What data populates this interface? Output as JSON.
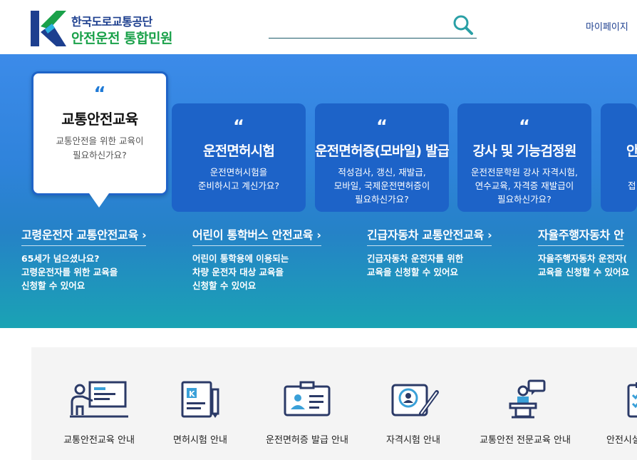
{
  "header": {
    "logo_top": "한국도로교통공단",
    "logo_bottom": "안전운전 통합민원",
    "search_placeholder": "",
    "mypage": "마이페이지"
  },
  "hero": {
    "main_card": {
      "title": "교통안전교육",
      "desc": "교통안전을 위한 교육이\n필요하신가요?"
    },
    "cards": [
      {
        "title": "운전면허시험",
        "desc": "운전면허시험을\n준비하시고 계신가요?"
      },
      {
        "title": "운전면허증(모바일) 발급",
        "desc": "적성검사, 갱신, 재발급,\n모바일, 국제운전면허증이\n필요하신가요?"
      },
      {
        "title": "강사 및 기능검정원",
        "desc": "운전전문학원 강사 자격시험,\n연수교육, 자격증 재발급이\n필요하신가요?"
      },
      {
        "title": "안",
        "desc": "\n접"
      }
    ],
    "education": [
      {
        "title": "고령운전자 교통안전교육 ›",
        "desc": "65세가 넘으셨나요?\n고령운전자를 위한 교육을\n신청할 수 있어요"
      },
      {
        "title": "어린이 통학버스 안전교육 ›",
        "desc": "어린이 통학용에 이용되는\n차량 운전자 대상 교육을\n신청할 수 있어요"
      },
      {
        "title": "긴급자동차 교통안전교육 ›",
        "desc": "긴급자동차 운전자를 위한\n교육을 신청할 수 있어요"
      },
      {
        "title": "자율주행자동차 안",
        "desc": "자율주행자동차 운전자(\n교육을 신청할 수 있어요"
      }
    ]
  },
  "services": [
    {
      "label": "교통안전교육 안내",
      "icon": "presentation-icon"
    },
    {
      "label": "면허시험 안내",
      "icon": "license-book-icon"
    },
    {
      "label": "운전면허증 발급 안내",
      "icon": "id-card-icon"
    },
    {
      "label": "자격시험 안내",
      "icon": "certificate-icon"
    },
    {
      "label": "교통안전 전문교육 안내",
      "icon": "lecturer-icon"
    },
    {
      "label": "안전시설",
      "icon": "checklist-icon"
    }
  ],
  "colors": {
    "brand_blue": "#1d3f8f",
    "brand_green": "#1aa14a",
    "card_blue": "#1d63c8",
    "icon_navy": "#2b3a67",
    "icon_accent": "#3aa0d8"
  }
}
